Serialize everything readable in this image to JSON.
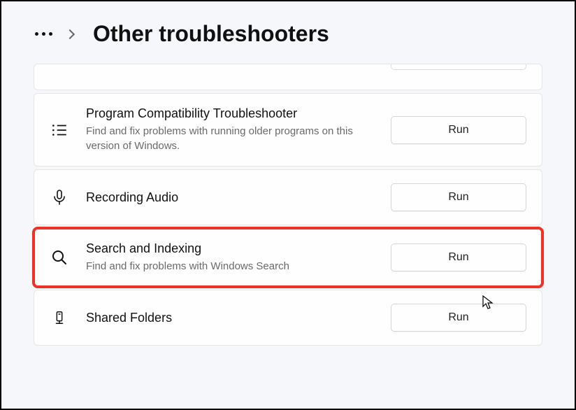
{
  "header": {
    "title": "Other troubleshooters"
  },
  "items": [
    {
      "title": "Program Compatibility Troubleshooter",
      "desc": "Find and fix problems with running older programs on this version of Windows.",
      "run": "Run"
    },
    {
      "title": "Recording Audio",
      "desc": "",
      "run": "Run"
    },
    {
      "title": "Search and Indexing",
      "desc": "Find and fix problems with Windows Search",
      "run": "Run"
    },
    {
      "title": "Shared Folders",
      "desc": "",
      "run": "Run"
    }
  ]
}
